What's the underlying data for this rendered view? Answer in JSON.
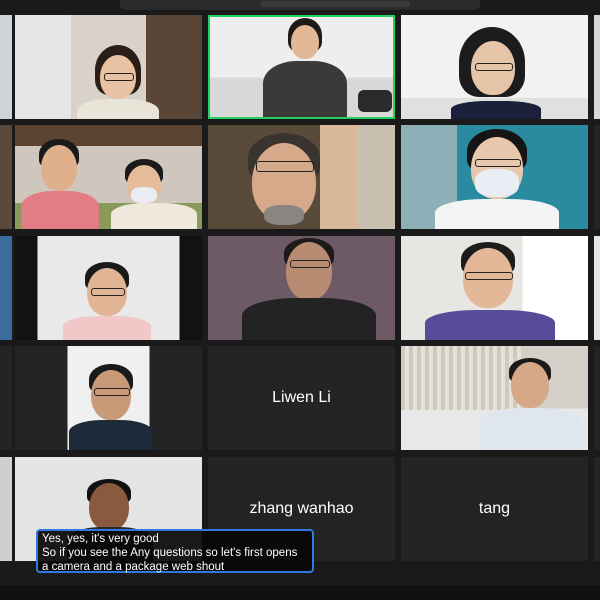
{
  "window": {
    "app": "Video meeting gallery view"
  },
  "participants": [
    {
      "id": "p1",
      "name": "",
      "shows_video": true
    },
    {
      "id": "p2",
      "name": "",
      "shows_video": true,
      "active_speaker": true
    },
    {
      "id": "p3",
      "name": "",
      "shows_video": true
    },
    {
      "id": "p4",
      "name": "",
      "shows_video": true
    },
    {
      "id": "p5",
      "name": "",
      "shows_video": true
    },
    {
      "id": "p6",
      "name": "",
      "shows_video": true
    },
    {
      "id": "p7",
      "name": "",
      "shows_video": true
    },
    {
      "id": "p8",
      "name": "",
      "shows_video": true
    },
    {
      "id": "p9",
      "name": "",
      "shows_video": true
    },
    {
      "id": "p10",
      "name": "",
      "shows_video": true
    },
    {
      "id": "p11",
      "name": "Liwen Li",
      "shows_video": false
    },
    {
      "id": "p12",
      "name": "",
      "shows_video": true
    },
    {
      "id": "p13",
      "name": "",
      "shows_video": true
    },
    {
      "id": "p14",
      "name": "zhang wanhao",
      "shows_video": false
    },
    {
      "id": "p15",
      "name": "tang",
      "shows_video": false
    }
  ],
  "captions": {
    "lines": [
      "Yes, yes, it's very good",
      "So if you see the Any questions so let's first opens",
      "a camera and a package web shout"
    ]
  },
  "colors": {
    "background": "#1a1a1a",
    "tile": "#242424",
    "active_speaker_border": "#23d160",
    "caption_border": "#2d7be0"
  }
}
